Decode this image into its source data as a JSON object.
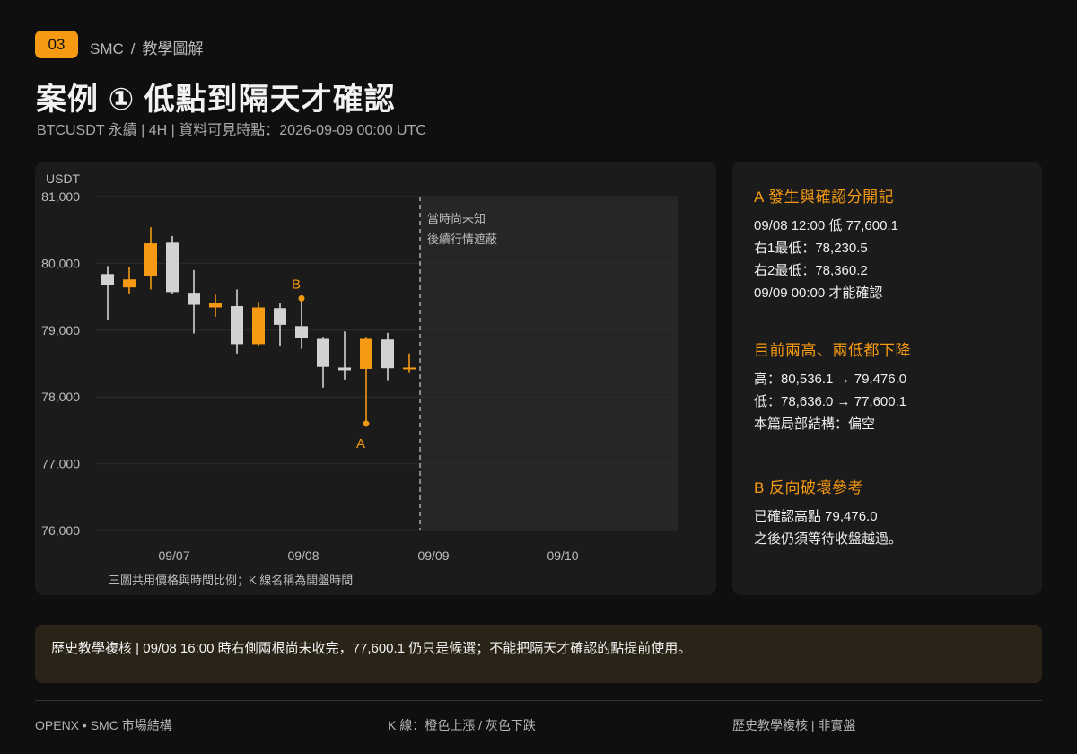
{
  "header": {
    "badge": "03",
    "breadcrumb_1": "SMC",
    "breadcrumb_sep": "/",
    "breadcrumb_2": "教學圖解",
    "title": "案例 ① 低點到隔天才確認",
    "subtitle": "BTCUSDT 永續 | 4H | 資料可見時點：2026-09-09 00:00 UTC"
  },
  "chart_data": {
    "type": "candlestick",
    "ylabel": "USDT",
    "ylim": [
      76000,
      81000
    ],
    "yticks": [
      "81,000",
      "80,000",
      "79,000",
      "78,000",
      "77,000",
      "76,000"
    ],
    "ytick_values": [
      81000,
      80000,
      79000,
      78000,
      77000,
      76000
    ],
    "xticks": [
      "09/07",
      "09/08",
      "09/09",
      "09/10"
    ],
    "colors": {
      "up": "#f59a12",
      "down": "#d2d2d2",
      "grid": "#2c2c2c",
      "accent": "#f59a12"
    },
    "candles": [
      {
        "o": 79840,
        "h": 79960,
        "l": 79150,
        "c": 79680
      },
      {
        "o": 79640,
        "h": 79950,
        "l": 79550,
        "c": 79760
      },
      {
        "o": 79810,
        "h": 80540,
        "l": 79610,
        "c": 80300
      },
      {
        "o": 80310,
        "h": 80410,
        "l": 79540,
        "c": 79570
      },
      {
        "o": 79560,
        "h": 79900,
        "l": 78950,
        "c": 79380
      },
      {
        "o": 79340,
        "h": 79530,
        "l": 79200,
        "c": 79400
      },
      {
        "o": 79360,
        "h": 79610,
        "l": 78650,
        "c": 78790
      },
      {
        "o": 78790,
        "h": 79410,
        "l": 78770,
        "c": 79340
      },
      {
        "o": 79330,
        "h": 79400,
        "l": 78760,
        "c": 79080
      },
      {
        "o": 79060,
        "h": 79476,
        "l": 78720,
        "c": 78880
      },
      {
        "o": 78870,
        "h": 78900,
        "l": 78140,
        "c": 78450
      },
      {
        "o": 78440,
        "h": 78980,
        "l": 78260,
        "c": 78400
      },
      {
        "o": 78420,
        "h": 78900,
        "l": 77600.1,
        "c": 78870
      },
      {
        "o": 78860,
        "h": 78960,
        "l": 78250,
        "c": 78430
      },
      {
        "o": 78420,
        "h": 78650,
        "l": 78370,
        "c": 78440
      }
    ],
    "annotations": [
      {
        "label": "A",
        "candle": 12,
        "value": 77600.1,
        "position": "below"
      },
      {
        "label": "B",
        "candle": 9,
        "value": 79476,
        "position": "above"
      }
    ],
    "masked_label_1": "當時尚未知",
    "masked_label_2": "後續行情遮蔽",
    "caption": "三圖共用價格與時間比例；K 線名稱為開盤時間"
  },
  "panel": {
    "s1_title": "A  發生與確認分開記",
    "s1_line1": "09/08 12:00 低 77,600.1",
    "s1_line2": "右1最低：78,230.5",
    "s1_line3": "右2最低：78,360.2",
    "s1_line4": "09/09 00:00 才能確認",
    "s2_title": "目前兩高、兩低都下降",
    "s2_line1": "高：80,536.1 → 79,476.0",
    "s2_line2": "低：78,636.0 → 77,600.1",
    "s2_line3": "本篇局部結構：偏空",
    "s3_title": "B  反向破壞參考",
    "s3_line1": "已確認高點 79,476.0",
    "s3_line2": "之後仍須等待收盤越過。"
  },
  "note": "歷史教學複核 | 09/08 16:00 時右側兩根尚未收完，77,600.1 仍只是候選；不能把隔天才確認的點提前使用。",
  "footer": {
    "left": "OPENX • SMC 市場結構",
    "center": "K 線：橙色上漲 / 灰色下跌",
    "right": "歷史教學複核 | 非實盤"
  }
}
